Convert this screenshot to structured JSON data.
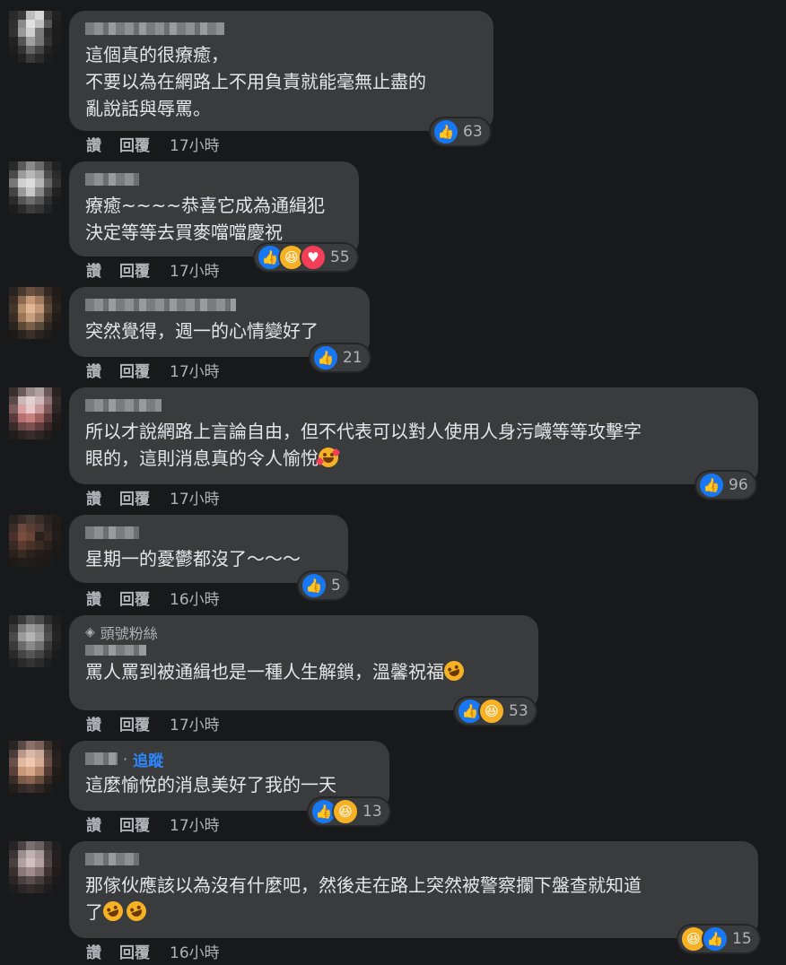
{
  "comments": [
    {
      "text": "這個真的很療癒，\n不要以為在網路上不用負責就能毫無止盡的\n亂說話與辱罵。",
      "actions": {
        "like": "讚",
        "reply": "回覆",
        "time": "17小時"
      },
      "reactions": {
        "icons": [
          "like-icon"
        ],
        "count": "63"
      }
    },
    {
      "text": "療癒~~~~恭喜它成為通緝犯\n決定等等去買麥噹噹慶祝",
      "actions": {
        "like": "讚",
        "reply": "回覆",
        "time": "17小時"
      },
      "reactions": {
        "icons": [
          "like-icon",
          "haha-icon",
          "love-icon"
        ],
        "count": "55"
      }
    },
    {
      "text": "突然覺得，週一的心情變好了",
      "actions": {
        "like": "讚",
        "reply": "回覆",
        "time": "17小時"
      },
      "reactions": {
        "icons": [
          "like-icon"
        ],
        "count": "21"
      }
    },
    {
      "text": "所以才說網路上言論自由，但不代表可以對人使用人身污衊等等攻擊字\n眼的，這則消息真的令人愉悅",
      "emoji_after": "smiling-face-with-hearts-emoji",
      "actions": {
        "like": "讚",
        "reply": "回覆",
        "time": "17小時"
      },
      "reactions": {
        "icons": [
          "like-icon"
        ],
        "count": "96"
      }
    },
    {
      "text": "星期一的憂鬱都沒了～～～",
      "actions": {
        "like": "讚",
        "reply": "回覆",
        "time": "16小時"
      },
      "reactions": {
        "icons": [
          "like-icon"
        ],
        "count": "5"
      }
    },
    {
      "badge": "頭號粉絲",
      "text": "罵人罵到被通緝也是一種人生解鎖，溫馨祝福",
      "emoji_after": "rolling-laughing-emoji",
      "actions": {
        "like": "讚",
        "reply": "回覆",
        "time": "17小時"
      },
      "reactions": {
        "icons": [
          "like-icon",
          "haha-icon"
        ],
        "count": "53"
      }
    },
    {
      "follow": "追蹤",
      "text": "這麼愉悅的消息美好了我的一天",
      "actions": {
        "like": "讚",
        "reply": "回覆",
        "time": "17小時"
      },
      "reactions": {
        "icons": [
          "like-icon",
          "haha-icon"
        ],
        "count": "13"
      }
    },
    {
      "text": "那傢伙應該以為沒有什麼吧，然後走在路上突然被警察攔下盤查就知道\n了",
      "emoji_after": "rolling-laughing-emoji x2",
      "actions": {
        "like": "讚",
        "reply": "回覆",
        "time": "16小時"
      },
      "reactions": {
        "icons": [
          "haha-icon",
          "like-icon"
        ],
        "count": "15"
      }
    }
  ],
  "colors": {
    "background": "#18191a",
    "bubble": "#3a3b3c",
    "text": "#e4e6eb",
    "secondary": "#b0b3b8",
    "like": "#1877f2",
    "follow": "#2d88ff"
  }
}
